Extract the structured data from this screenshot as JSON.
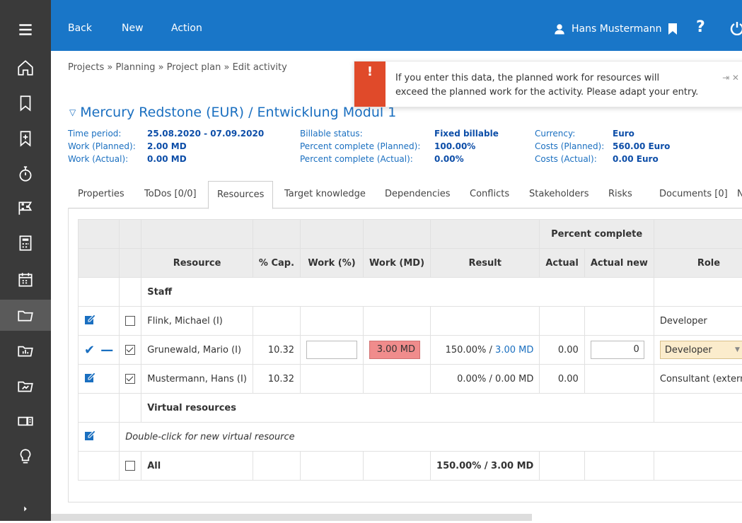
{
  "topbar": {
    "back": "Back",
    "new": "New",
    "action": "Action",
    "user": "Hans Mustermann"
  },
  "breadcrumb": "Projects » Planning » Project plan » Edit activity",
  "alert": {
    "message": "If you enter this data, the planned work for resources will\nexceed the planned work for the activity. Please adapt your entry.",
    "controls": "⇥ ✕"
  },
  "title": "Mercury Redstone (EUR) / Entwicklung Modul 1",
  "meta": {
    "time_period_label": "Time period:",
    "time_period": "25.08.2020 - 07.09.2020",
    "work_planned_label": "Work (Planned):",
    "work_planned": "2.00 MD",
    "work_actual_label": "Work (Actual):",
    "work_actual": "0.00 MD",
    "billable_label": "Billable status:",
    "billable": "Fixed billable",
    "pc_planned_label": "Percent complete (Planned):",
    "pc_planned": "100.00%",
    "pc_actual_label": "Percent complete (Actual):",
    "pc_actual": "0.00%",
    "currency_label": "Currency:",
    "currency": "Euro",
    "costs_planned_label": "Costs (Planned):",
    "costs_planned": "560.00 Euro",
    "costs_actual_label": "Costs (Actual):",
    "costs_actual": "0.00 Euro"
  },
  "tabs": [
    "Properties",
    "ToDos [0/0]",
    "Resources",
    "Target knowledge",
    "Dependencies",
    "Conflicts",
    "Stakeholders",
    "Risks",
    "Documents [0]",
    "N"
  ],
  "table": {
    "group_header": "Percent complete",
    "headers": {
      "resource": "Resource",
      "cap": "% Cap.",
      "work_pct": "Work (%)",
      "work_md": "Work (MD)",
      "result": "Result",
      "actual": "Actual",
      "actual_new": "Actual new",
      "role": "Role"
    },
    "staff": "Staff",
    "rows": [
      {
        "name": "Flink, Michael (I)",
        "cap": "",
        "result": "",
        "actual": "",
        "role": "Developer",
        "checked": false
      },
      {
        "name": "Grunewald, Mario (I)",
        "cap": "10.32",
        "work_md": "3.00 MD",
        "result_pct": "150.00% / ",
        "result_md": "3.00 MD",
        "actual": "0.00",
        "actual_new": "0",
        "role": "Developer",
        "checked": true
      },
      {
        "name": "Mustermann, Hans (I)",
        "cap": "10.32",
        "result": "0.00% / 0.00 MD",
        "actual": "0.00",
        "role": "Consultant (external)",
        "checked": true
      }
    ],
    "virtual": "Virtual resources",
    "new_virtual": "Double-click for new virtual resource",
    "all": "All",
    "all_result": "150.00% / 3.00 MD"
  }
}
